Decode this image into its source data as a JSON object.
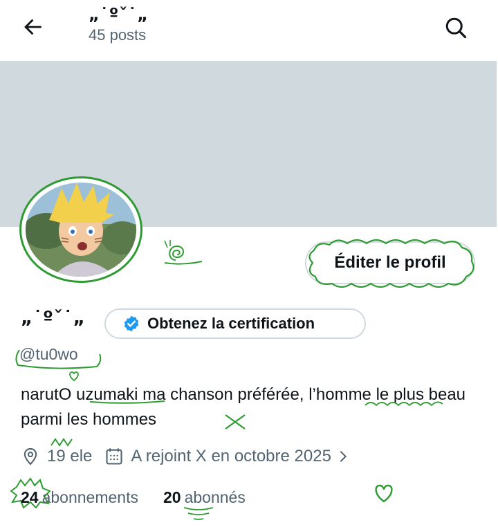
{
  "header": {
    "title": "„˙ºˇ˙„",
    "posts_count": "45 posts"
  },
  "profile": {
    "display_name": "„˙ºˇ˙„",
    "edit_button": "Éditer le profil",
    "certification_button": "Obtenez la certification",
    "handle": "@tu0wo",
    "bio": "narutO uzumaki ma chanson préférée, l’homme le plus beau parmi les hommes",
    "location": "19 ele",
    "joined": "A rejoint X en octobre 2025",
    "following_count": "24",
    "following_label": "abonnements",
    "followers_count": "20",
    "followers_label": "abonnés"
  },
  "colors": {
    "doodle_green": "#2e9b32",
    "verified_blue": "#1d9bf0",
    "banner": "#cfd9de",
    "secondary_text": "#536471"
  },
  "icons": [
    "back-arrow-icon",
    "search-icon",
    "verified-badge-icon",
    "location-pin-icon",
    "calendar-icon",
    "chevron-right-icon",
    "snail-doodle",
    "heart-doodle"
  ]
}
